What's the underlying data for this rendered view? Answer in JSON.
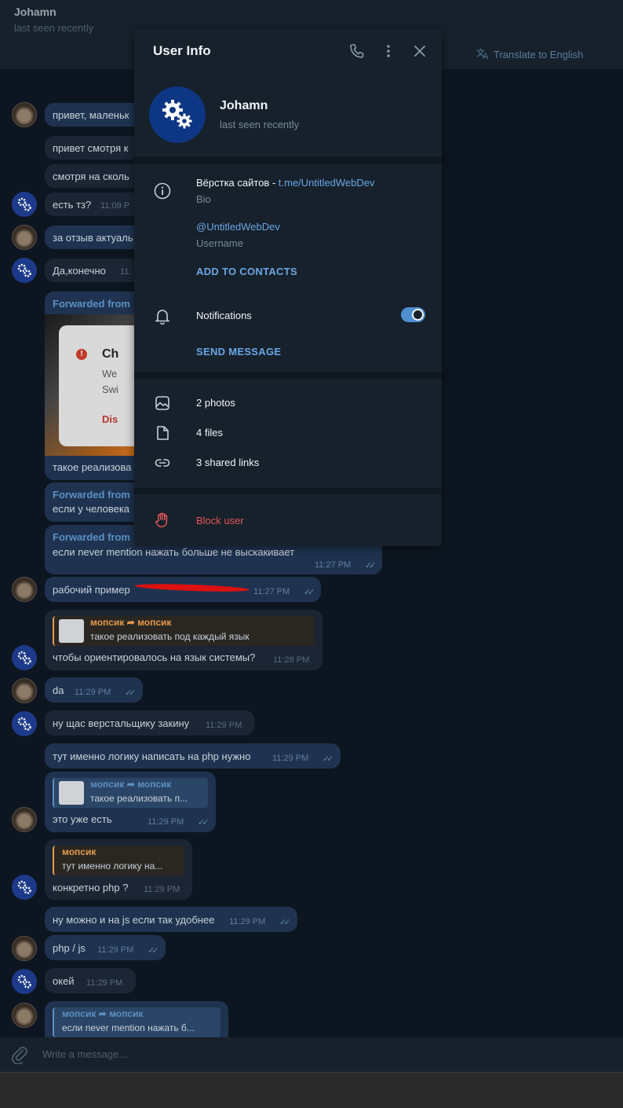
{
  "header": {
    "name": "Johamn",
    "status": "last seen recently",
    "translate": "Translate to English"
  },
  "messages": {
    "m1": "привет, маленьк",
    "m2": "привет смотря к",
    "m3": "смотря на сколь",
    "m4": "есть тз?",
    "m4_time": "11:09 P",
    "m5": "за отзыв актуаль",
    "m6": "Да,конечно",
    "m6_time": "11:",
    "m7_fwd": "Forwarded from",
    "m7_txt": "такое реализова",
    "dlg_title": "Ch",
    "dlg_l1": "We",
    "dlg_l2": "Swi",
    "dlg_btn": "Dis",
    "m8_fwd": "Forwarded from",
    "m8_txt": "если у человека",
    "m9_fwd": "Forwarded from",
    "m9_txt": "если never mention нажать больше не выскакивает",
    "m9_time": "11:27 PM",
    "m10": "рабочий пример",
    "m10_time": "11:27 PM",
    "m11_rname": "мопсик ➦ мопсик",
    "m11_rtext": "такое реализовать под каждый язык",
    "m11": "чтобы ориентировалось на язык системы?",
    "m11_time": "11:28 PM",
    "m12": "da",
    "m12_time": "11:29 PM",
    "m13": "ну щас верстальщику закину",
    "m13_time": "11:29 PM",
    "m14": "тут именно логику написать на php нужно",
    "m14_time": "11:29 PM",
    "m15_rname": "мопсик ➦ мопсик",
    "m15_rtext": "такое реализовать п...",
    "m15": "это уже есть",
    "m15_time": "11:29 PM",
    "m16_rname": "мопсик",
    "m16_rtext": "тут именно логику на...",
    "m16": "конкретно php ?",
    "m16_time": "11:29 PM",
    "m17": "ну можно и на js если так удобнее",
    "m17_time": "11:29 PM",
    "m18": "php / js",
    "m18_time": "11:29 PM",
    "m19": "окей",
    "m19_time": "11:29 PM",
    "m20_rname": "мопсик ➦ мопсик",
    "m20_rtext": "если never mention нажать б..."
  },
  "composer": {
    "placeholder": "Write a message..."
  },
  "panel": {
    "title": "User Info",
    "name": "Johamn",
    "status": "last seen recently",
    "bio_text": "Вёрстка сайтов - ",
    "bio_link": "t.me/UntitledWebDev",
    "bio_label": "Bio",
    "username": "@UntitledWebDev",
    "username_label": "Username",
    "add_contacts": "ADD TO CONTACTS",
    "notifications": "Notifications",
    "notifications_on": true,
    "send_message": "SEND MESSAGE",
    "photos": "2 photos",
    "files": "4 files",
    "links": "3 shared links",
    "block": "Block user"
  },
  "colors": {
    "accent": "#69a7e6",
    "danger": "#e25656",
    "panel_bg": "#17212b",
    "out_bubble": "#1f3350"
  }
}
